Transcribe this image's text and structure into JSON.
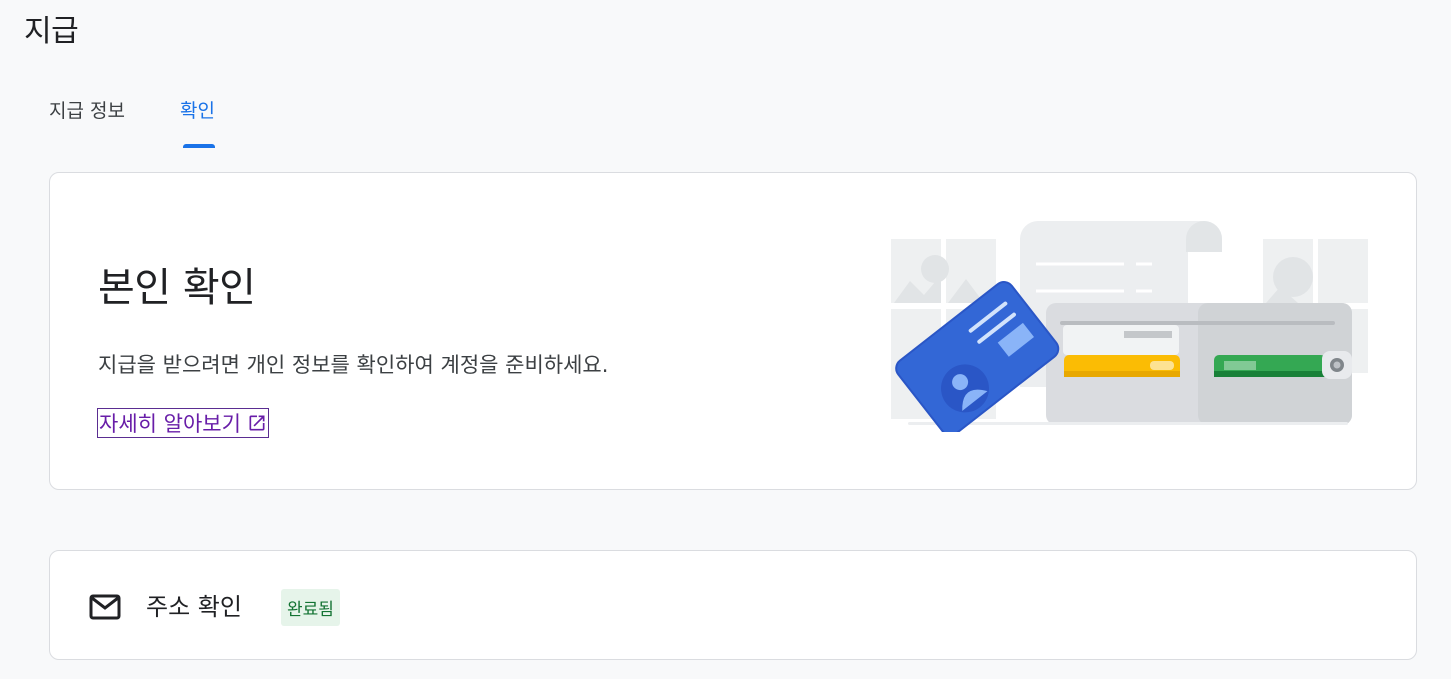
{
  "page": {
    "title": "지급"
  },
  "tabs": [
    {
      "label": "지급 정보",
      "selected": false
    },
    {
      "label": "확인",
      "selected": true
    }
  ],
  "identity_card": {
    "title": "본인 확인",
    "description": "지급을 받으려면 개인 정보를 확인하여 계정을 준비하세요.",
    "learn_more_label": "자세히 알아보기",
    "illustration": "wallet-and-id-card-illustration"
  },
  "address_card": {
    "label": "주소 확인",
    "status": "완료됨",
    "icon": "mail-icon"
  },
  "colors": {
    "accent": "#1a73e8",
    "link": "#681da8",
    "status_bg": "#e6f4ea",
    "status_text": "#137333"
  }
}
